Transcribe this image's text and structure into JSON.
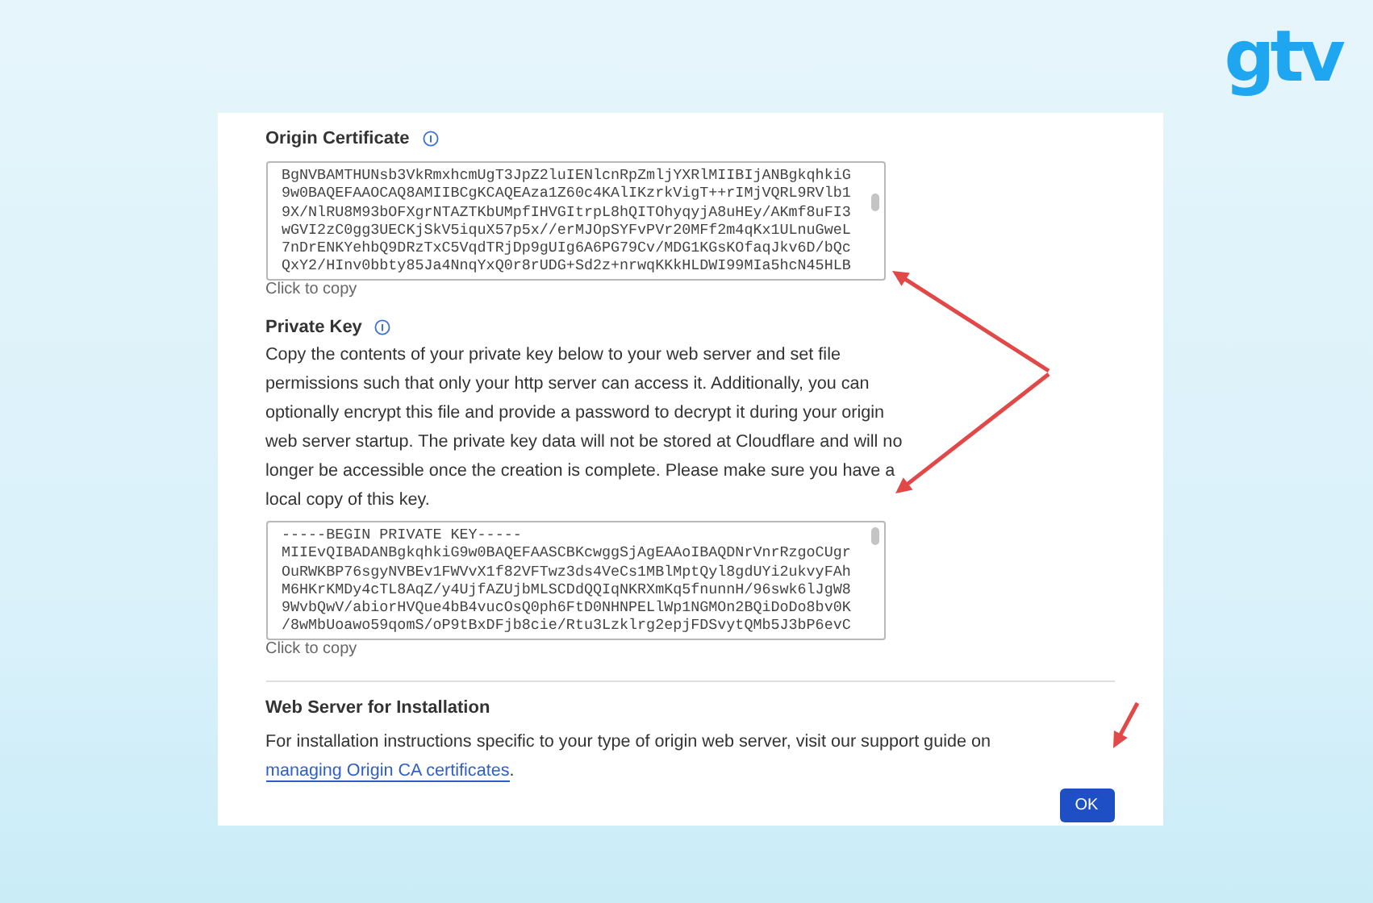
{
  "logo": "gtv",
  "certificate": {
    "title": "Origin Certificate",
    "lines": [
      "BgNVBAMTHUNsb3VkRmxhcmUgT3JpZ2luIENlcnRpZmljYXRlMIIBIjANBgkqhkiG",
      "9w0BAQEFAAOCAQ8AMIIBCgKCAQEAza1Z60c4KAlIKzrkVigT++rIMjVQRL9RVlb1",
      "9X/NlRU8M93bOFXgrNTAZTKbUMpfIHVGItrpL8hQITOhyqyjA8uHEy/AKmf8uFI3",
      "wGVI2zC0gg3UECKjSkV5iquX57p5x//erMJOpSYFvPVr20MFf2m4qKx1ULnuGweL",
      "7nDrENKYehbQ9DRzTxC5VqdTRjDp9gUIg6A6PG79Cv/MDG1KGsKOfaqJkv6D/bQc",
      "QxY2/HInv0bbty85Ja4NnqYxQ0r8rUDG+Sd2z+nrwqKKkHLDWI99MIa5hcN45HLB"
    ],
    "copy_hint": "Click to copy"
  },
  "private_key": {
    "title": "Private Key",
    "description": "Copy the contents of your private key below to your web server and set file permissions such that only your http server can access it. Additionally, you can optionally encrypt this file and provide a password to decrypt it during your origin web server startup. The private key data will not be stored at Cloudflare and will no longer be accessible once the creation is complete. Please make sure you have a local copy of this key.",
    "lines": [
      "-----BEGIN PRIVATE KEY-----",
      "MIIEvQIBADANBgkqhkiG9w0BAQEFAASCBKcwggSjAgEAAoIBAQDNrVnrRzgoCUgr",
      "OuRWKBP76sgyNVBEv1FWVvX1f82VFTwz3ds4VeCs1MBlMptQyl8gdUYi2ukvyFAh",
      "M6HKrKMDy4cTL8AqZ/y4UjfAZUjbMLSCDdQQIqNKRXmKq5fnunnH/96swk6lJgW8",
      "9WvbQwV/abiorHVQue4bB4vucOsQ0ph6FtD0NHNPELlWp1NGMOn2BQiDoDo8bv0K",
      "/8wMbUoawo59qomS/oP9tBxDFjb8cie/Rtu3Lzklrg2epjFDSvytQMb5J3bP6evC"
    ],
    "copy_hint": "Click to copy"
  },
  "installation": {
    "title": "Web Server for Installation",
    "text": "For installation instructions specific to your type of origin web server, visit our support guide on",
    "link": "managing Origin CA certificates",
    "after": "."
  },
  "buttons": [
    {
      "label": "OK"
    }
  ]
}
